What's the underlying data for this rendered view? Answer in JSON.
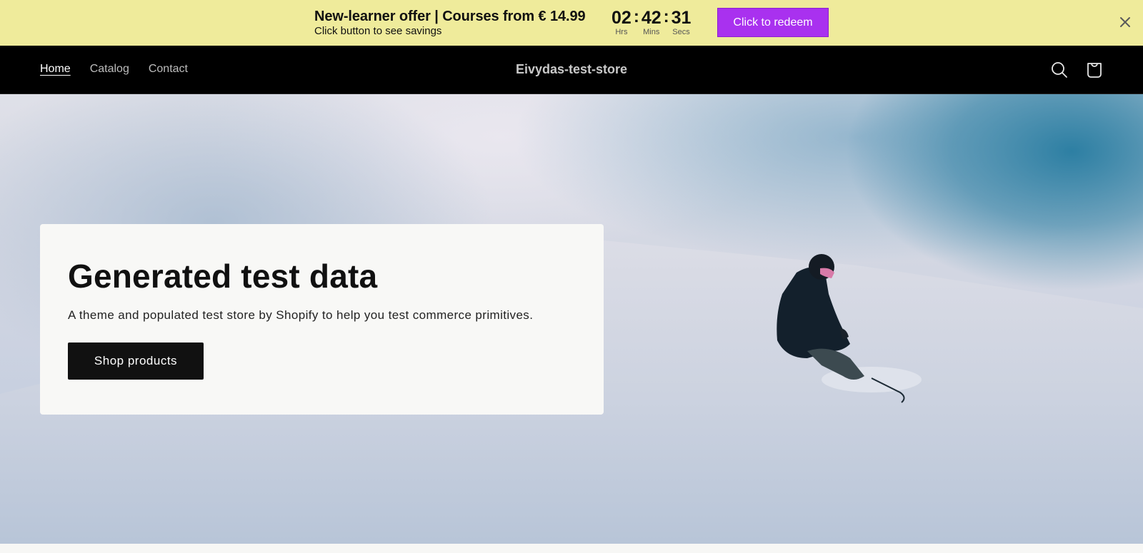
{
  "promo": {
    "title": "New-learner offer | Courses from € 14.99",
    "subtitle": "Click button to see savings",
    "countdown": {
      "hours": "02",
      "minutes": "42",
      "seconds": "31",
      "hours_label": "Hrs",
      "minutes_label": "Mins",
      "seconds_label": "Secs",
      "separator": ":"
    },
    "cta_label": "Click to redeem",
    "close_icon": "close-icon",
    "colors": {
      "background": "#efeb9b",
      "cta": "#a931ef"
    }
  },
  "header": {
    "nav": [
      {
        "label": "Home",
        "active": true
      },
      {
        "label": "Catalog",
        "active": false
      },
      {
        "label": "Contact",
        "active": false
      }
    ],
    "brand": "Eivydas-test-store",
    "icons": [
      "search-icon",
      "cart-icon"
    ]
  },
  "hero": {
    "title": "Generated test data",
    "subtitle": "A theme and populated test store by Shopify to help you test commerce primitives.",
    "cta_label": "Shop products",
    "image": "snowboarder-icon"
  }
}
